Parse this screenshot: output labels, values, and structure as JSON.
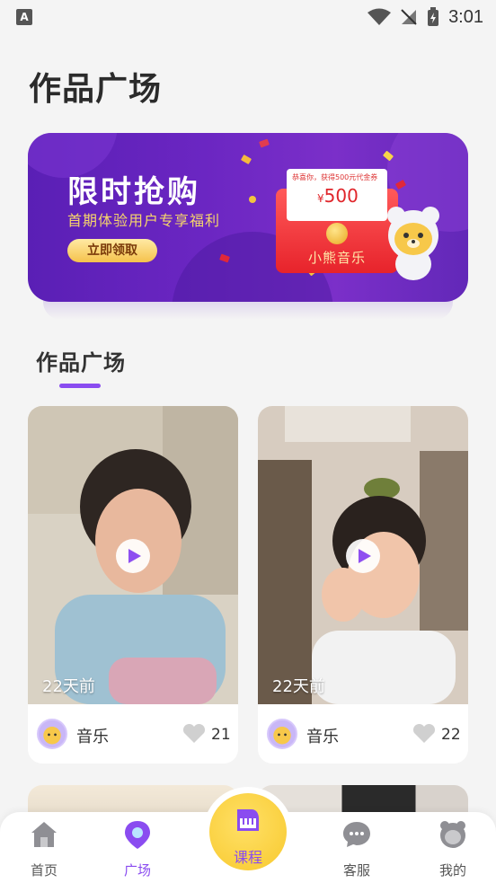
{
  "status_bar": {
    "time": "3:01",
    "app_icon_letter": "A"
  },
  "page": {
    "title": "作品广场"
  },
  "banner": {
    "headline": "限时抢购",
    "subtitle": "首期体验用户专享福利",
    "cta_label": "立即领取",
    "envelope_note": "恭喜你，获得500元代金券",
    "envelope_amount_symbol": "¥",
    "envelope_amount": "500",
    "brand": "小熊音乐"
  },
  "section": {
    "title": "作品广场"
  },
  "works": [
    {
      "time_ago": "22天前",
      "author": "音乐",
      "likes": "21"
    },
    {
      "time_ago": "22天前",
      "author": "音乐",
      "likes": "22"
    }
  ],
  "tabbar": {
    "items": [
      {
        "label": "首页",
        "active": false
      },
      {
        "label": "广场",
        "active": true
      },
      {
        "label": "课程",
        "active": false
      },
      {
        "label": "客服",
        "active": false
      },
      {
        "label": "我的",
        "active": false
      }
    ],
    "accent": "#8a4cf0",
    "center_color": "#f8c92e"
  }
}
